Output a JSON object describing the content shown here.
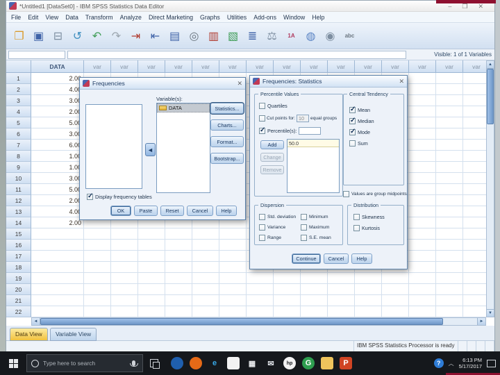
{
  "window": {
    "title": "*Untitled1 [DataSet0] - IBM SPSS Statistics Data Editor",
    "controls": {
      "minimize": "–",
      "maximize": "❐",
      "close": "✕"
    }
  },
  "glyphs": {
    "arrow_left": "◄",
    "hscroll_left": "◄",
    "hscroll_right": "►",
    "vscroll_up": "▲",
    "vscroll_down": "▼",
    "check": "✓"
  },
  "menu": {
    "items": [
      {
        "name": "file",
        "label": "File"
      },
      {
        "name": "edit",
        "label": "Edit"
      },
      {
        "name": "view",
        "label": "View"
      },
      {
        "name": "data",
        "label": "Data"
      },
      {
        "name": "transform",
        "label": "Transform"
      },
      {
        "name": "analyze",
        "label": "Analyze"
      },
      {
        "name": "direct-marketing",
        "label": "Direct Marketing"
      },
      {
        "name": "graphs",
        "label": "Graphs"
      },
      {
        "name": "utilities",
        "label": "Utilities"
      },
      {
        "name": "add-ons",
        "label": "Add-ons"
      },
      {
        "name": "window",
        "label": "Window"
      },
      {
        "name": "help",
        "label": "Help"
      }
    ]
  },
  "toolbar": {
    "icons": [
      {
        "name": "open-data-icon",
        "glyph": "❐",
        "color": "#d99a2b"
      },
      {
        "name": "save-icon",
        "glyph": "▣",
        "color": "#3f63a8"
      },
      {
        "name": "print-icon",
        "glyph": "⊟",
        "color": "#7d8ea0"
      },
      {
        "name": "recall-dialogs-icon",
        "glyph": "↺",
        "color": "#3f8fc0"
      },
      {
        "name": "undo-icon",
        "glyph": "↶",
        "color": "#3f9d57"
      },
      {
        "name": "redo-icon",
        "glyph": "↷",
        "color": "#9aa4ad"
      },
      {
        "name": "goto-case-icon",
        "glyph": "⇥",
        "color": "#b03a2e"
      },
      {
        "name": "goto-variable-icon",
        "glyph": "⇤",
        "color": "#3f63a8"
      },
      {
        "name": "variables-icon",
        "glyph": "▤",
        "color": "#3f63a8"
      },
      {
        "name": "find-icon",
        "glyph": "◎",
        "color": "#6b7680"
      },
      {
        "name": "insert-cases-icon",
        "glyph": "▥",
        "color": "#b03a2e"
      },
      {
        "name": "insert-variable-icon",
        "glyph": "▧",
        "color": "#3f9d57"
      },
      {
        "name": "split-file-icon",
        "glyph": "≣",
        "color": "#3f63a8"
      },
      {
        "name": "weight-cases-icon",
        "glyph": "⚖",
        "color": "#7d8ea0"
      },
      {
        "name": "value-labels-icon",
        "glyph": "1A",
        "color": "#b03a5e"
      },
      {
        "name": "use-variable-sets-icon",
        "glyph": "◍",
        "color": "#5b84c4"
      },
      {
        "name": "show-all-variables-icon",
        "glyph": "◉",
        "color": "#7d8ea0"
      },
      {
        "name": "spell-check-icon",
        "glyph": "abc",
        "color": "#6b7680"
      }
    ]
  },
  "grid": {
    "visible_label": "Visible: 1 of 1 Variables",
    "data_header": "DATA",
    "var_header": "var",
    "var_columns": 16,
    "row_count": 22,
    "values": [
      "2.00",
      "4.00",
      "3.00",
      "2.00",
      "5.00",
      "3.00",
      "6.00",
      "1.00",
      "1.00",
      "3.00",
      "5.00",
      "2.00",
      "4.00",
      "2.00"
    ]
  },
  "tabs": {
    "data_view": "Data View",
    "variable_view": "Variable View"
  },
  "status_bar": {
    "message": "IBM SPSS Statistics Processor is ready"
  },
  "taskbar": {
    "search_placeholder": "Type here to search",
    "time": "6:13 PM",
    "date": "5/17/2017",
    "icons": [
      {
        "name": "cortana-icon",
        "glyph": "",
        "bg": "#1f5fae",
        "fg": "#cfe4ff",
        "shape": "circle"
      },
      {
        "name": "firefox-icon",
        "glyph": "",
        "bg": "#e66a17",
        "fg": "#ffd27a",
        "shape": "circle"
      },
      {
        "name": "edge-icon",
        "glyph": "e",
        "bg": "",
        "fg": "#38a9e8",
        "shape": "glyph"
      },
      {
        "name": "store-icon",
        "glyph": "",
        "bg": "#f2f2f2",
        "fg": "#111111",
        "shape": "square"
      },
      {
        "name": "calculator-icon",
        "glyph": "▦",
        "bg": "",
        "fg": "#e8eaec",
        "shape": "glyph"
      },
      {
        "name": "mail-icon",
        "glyph": "✉",
        "bg": "",
        "fg": "#dfe3e8",
        "shape": "glyph"
      },
      {
        "name": "hp-icon",
        "glyph": "hp",
        "bg": "#f2f2f2",
        "fg": "#15181c",
        "shape": "circle"
      },
      {
        "name": "groove-icon",
        "glyph": "G",
        "bg": "#2e9e4f",
        "fg": "#ffffff",
        "shape": "circle"
      },
      {
        "name": "file-explorer-icon",
        "glyph": "",
        "bg": "#efc45c",
        "fg": "#ffffff",
        "shape": "square"
      },
      {
        "name": "powerpoint-icon",
        "glyph": "P",
        "bg": "#d04423",
        "fg": "#ffffff",
        "shape": "square"
      }
    ]
  },
  "freq_dialog": {
    "title": "Frequencies",
    "variables_label": "Variable(s):",
    "selected_variable": "DATA",
    "side_buttons": [
      {
        "name": "statistics-button",
        "label": "Statistics..."
      },
      {
        "name": "charts-button",
        "label": "Charts..."
      },
      {
        "name": "format-button",
        "label": "Format..."
      },
      {
        "name": "bootstrap-button",
        "label": "Bootstrap..."
      }
    ],
    "display_freq": {
      "label": "Display frequency tables",
      "checked": true
    },
    "buttons": [
      {
        "name": "ok-button",
        "label": "OK"
      },
      {
        "name": "paste-button",
        "label": "Paste"
      },
      {
        "name": "reset-button",
        "label": "Reset"
      },
      {
        "name": "cancel-button",
        "label": "Cancel"
      },
      {
        "name": "help-button",
        "label": "Help"
      }
    ]
  },
  "stats_dialog": {
    "title": "Frequencies: Statistics",
    "percentile_values": {
      "label": "Percentile Values",
      "quartiles": {
        "label": "Quartiles",
        "checked": false
      },
      "cut_points": {
        "label": "Cut points for:",
        "checked": false,
        "value": "10",
        "suffix": "equal groups"
      },
      "percentiles": {
        "label": "Percentile(s):",
        "checked": true,
        "input": ""
      },
      "add_label": "Add",
      "change_label": "Change",
      "remove_label": "Remove",
      "list_items": [
        "50.0"
      ]
    },
    "central_tendency": {
      "label": "Central Tendency",
      "items": [
        {
          "label": "Mean",
          "checked": true
        },
        {
          "label": "Median",
          "checked": true
        },
        {
          "label": "Mode",
          "checked": true
        },
        {
          "label": "Sum",
          "checked": false
        }
      ]
    },
    "midpoints": {
      "label": "Values are group midpoints",
      "checked": false
    },
    "dispersion": {
      "label": "Dispersion",
      "items": [
        {
          "label": "Std. deviation",
          "checked": false
        },
        {
          "label": "Variance",
          "checked": false
        },
        {
          "label": "Range",
          "checked": false
        },
        {
          "label": "Minimum",
          "checked": false
        },
        {
          "label": "Maximum",
          "checked": false
        },
        {
          "label": "S.E. mean",
          "checked": false
        }
      ]
    },
    "distribution": {
      "label": "Distribution",
      "items": [
        {
          "label": "Skewness",
          "checked": false
        },
        {
          "label": "Kurtosis",
          "checked": false
        }
      ]
    },
    "buttons": [
      {
        "name": "continue-button",
        "label": "Continue"
      },
      {
        "name": "cancel-button",
        "label": "Cancel"
      },
      {
        "name": "help-button",
        "label": "Help"
      }
    ]
  }
}
